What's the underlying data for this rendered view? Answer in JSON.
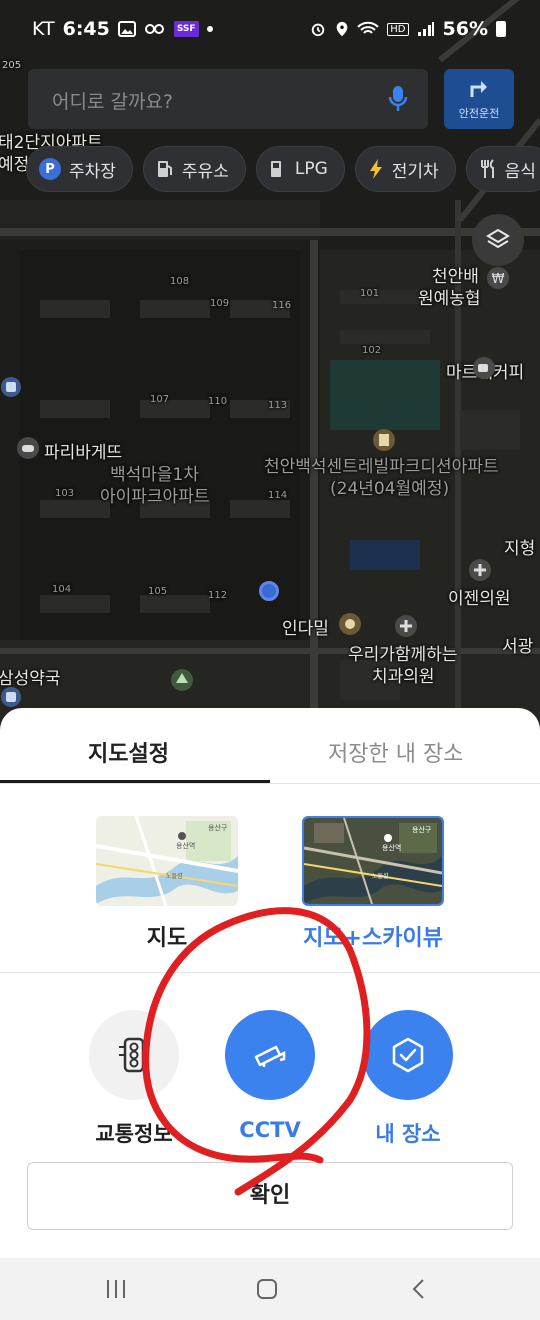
{
  "status_bar": {
    "carrier": "KT",
    "time": "6:45",
    "ssf_badge": "SSF",
    "network_badge": "HD",
    "battery": "56%"
  },
  "search": {
    "placeholder": "어디로 갈까요?",
    "nav_button_label": "안전운전"
  },
  "chips": [
    {
      "label": "주차장",
      "icon": "parking-icon",
      "color": "#3a6fd8"
    },
    {
      "label": "주유소",
      "icon": "gas-station-icon",
      "color": "#d0d0d0"
    },
    {
      "label": "LPG",
      "icon": "lpg-icon",
      "color": "#d0d0d0"
    },
    {
      "label": "전기차",
      "icon": "lightning-icon",
      "color": "#f2c231"
    },
    {
      "label": "음식",
      "icon": "fork-knife-icon",
      "color": "#d0d0d0"
    }
  ],
  "map_labels": {
    "paris": "파리바게뜨",
    "baekseok": "백석마을1차",
    "ipark": "아이파크아파트",
    "cheonan_bank": "천안배",
    "nonghyup": "원예농협",
    "mare": "마르페커피",
    "apartment_title": "천안백석센트레빌파크디션아파트",
    "apartment_sub": "(24년04월예정)",
    "ijen": "이젠의원",
    "woori": "우리가함께하는",
    "dental": "치과의원",
    "indamil": "인다밀",
    "pharmacy": "삼성약국",
    "jihyeong": "지형",
    "seogwang": "서광",
    "top_left_1": "태2단지아파트",
    "top_left_2": "예정",
    "bldg_101": "101",
    "bldg_102": "102",
    "bldg_103": "103",
    "bldg_104": "104",
    "bldg_105": "105",
    "bldg_107": "107",
    "bldg_108": "108",
    "bldg_109": "109",
    "bldg_110": "110",
    "bldg_112": "112",
    "bldg_113": "113",
    "bldg_114": "114",
    "bldg_116": "116",
    "bldg_205": "205"
  },
  "sheet": {
    "tab_settings": "지도설정",
    "tab_saved": "저장한 내 장소",
    "map_type_map": "지도",
    "map_type_sky": "지도+스카이뷰",
    "opt_traffic": "교통정보",
    "opt_cctv": "CCTV",
    "opt_myplace": "내 장소",
    "confirm": "확인"
  },
  "thumb_text": {
    "yongsan_station": "용산역",
    "yongsan_gu": "용산구",
    "nodeul": "노들섬"
  },
  "colors": {
    "accent": "#3b82ee",
    "annotation": "#e02020"
  }
}
